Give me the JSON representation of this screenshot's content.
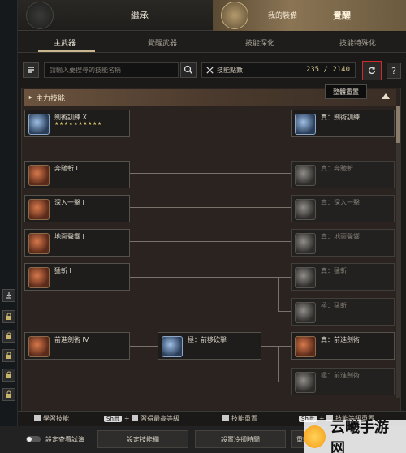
{
  "header": {
    "tab_inherit": "繼承",
    "awakening_sub": "我的裝備",
    "awakening_main": "覺醒"
  },
  "subtabs": [
    "主武器",
    "覺醒武器",
    "技能深化",
    "技能特殊化"
  ],
  "search": {
    "placeholder": "請輸入要搜尋的技能名稱"
  },
  "points": {
    "label": "技能點數",
    "value": "235 / 2140"
  },
  "tooltip": "整體重置",
  "section": {
    "title": "主力技能"
  },
  "skills_left": [
    {
      "name": "劍術訓練 X",
      "stars": "★★★★★★★★★★"
    },
    {
      "name": "奔馳斬 I",
      "sub": ""
    },
    {
      "name": "深入一擊 I",
      "sub": ""
    },
    {
      "name": "地面聲響 I",
      "sub": ""
    },
    {
      "name": "猛斬 I",
      "sub": ""
    },
    {
      "name": "前進劍術 IV",
      "sub": ""
    }
  ],
  "skill_mid": {
    "name": "極：前移砍擊"
  },
  "skills_right": [
    {
      "name": "真：劍術訓練"
    },
    {
      "name": "真：奔馳斬"
    },
    {
      "name": "真：深入一擊"
    },
    {
      "name": "真：地面聲響"
    },
    {
      "name": "真：猛斬"
    },
    {
      "name": "極：猛斬"
    },
    {
      "name": "真：前進劍術"
    },
    {
      "name": "極：前進劍術"
    }
  ],
  "bottom_bar": {
    "learn": "學習技能",
    "shift": "Shift",
    "learn_max": "習得最高等級",
    "reset_skill": "技能重置",
    "reset_level": "技能等級重置"
  },
  "footer": {
    "preview": "設定查看試演",
    "set_bar": "設定技能欄",
    "set_cooldown": "設置冷卻時間",
    "set_cmd": "重新"
  },
  "watermark": "云曦手游网",
  "colors": {
    "accent": "#d9c68c",
    "reset_border": "#d22a2a"
  }
}
